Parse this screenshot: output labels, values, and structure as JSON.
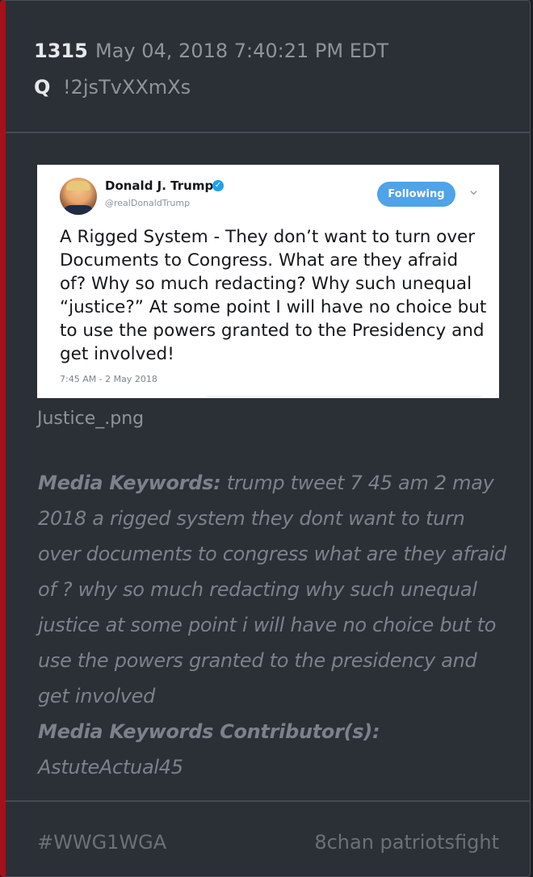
{
  "post": {
    "number": "1315",
    "date": "May 04, 2018 7:40:21 PM EDT",
    "author_letter": "Q",
    "tripcode": "!2jsTvXXmXs"
  },
  "tweet": {
    "name": "Donald J. Trump",
    "handle": "@realDonaldTrump",
    "follow_label": "Following",
    "text": "A Rigged System - They don’t want to turn over Documents to Congress. What are they afraid of? Why so much redacting? Why such unequal “justice?” At some point I will have no choice but to use the powers granted to the Presidency and get involved!",
    "timestamp": "7:45 AM - 2 May 2018",
    "verified_color": "#1da1f2",
    "button_color": "#4fa3e8"
  },
  "image": {
    "filename": "Justice_.png"
  },
  "media": {
    "keywords_label": "Media Keywords:",
    "keywords_text": "trump tweet 7 45 am 2 may 2018 a rigged system they dont want to turn over documents to congress what are they afraid of ? why so much redacting why such unequal justice at some point i will have no choice but to use the powers granted to the presidency and get involved",
    "contributors_label": "Media Keywords Contributor(s):",
    "contributors_text": "AstuteActual45"
  },
  "footer": {
    "hashtag": "#WWG1WGA",
    "site": "8chan patriotsfight"
  },
  "colors": {
    "accent_bar": "#a5101b",
    "card_bg": "#2b2f36"
  }
}
